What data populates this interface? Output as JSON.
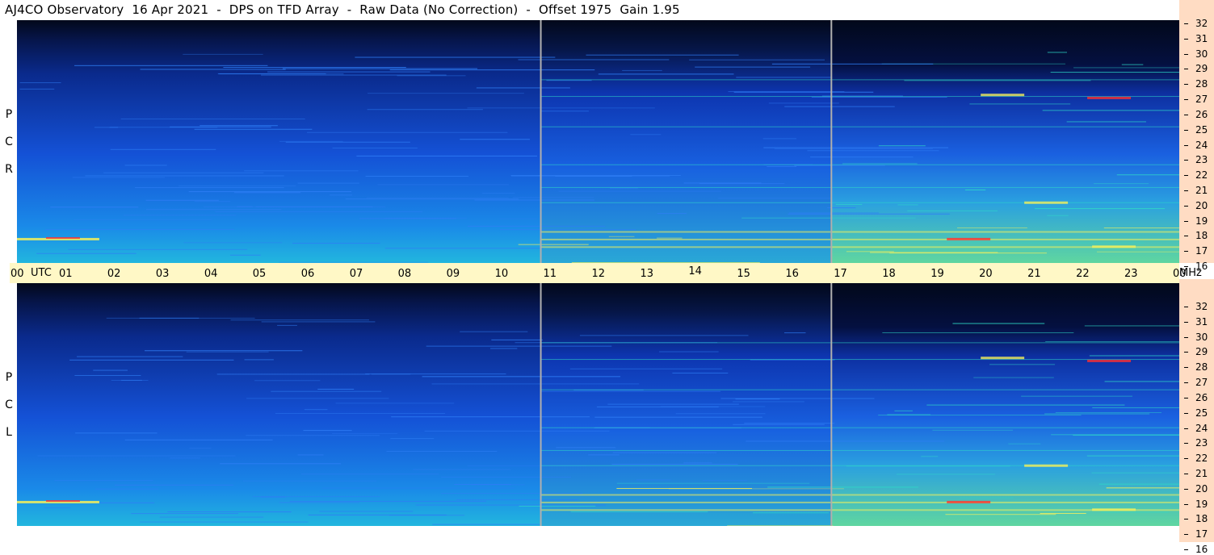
{
  "title": "AJ4CO Observatory  16 Apr 2021  -  DPS on TFD Array  -  Raw Data (No Correction)  -  Offset 1975  Gain 1.95",
  "panels": {
    "rcp": {
      "label_letters": [
        "R",
        "C",
        "P"
      ]
    },
    "lcp": {
      "label_letters": [
        "L",
        "C",
        "P"
      ]
    }
  },
  "time_axis": {
    "unit_label": "UTC",
    "freq_unit": "MHz",
    "ticks": [
      "00",
      "01",
      "02",
      "03",
      "04",
      "05",
      "06",
      "07",
      "08",
      "09",
      "10",
      "11",
      "12",
      "13",
      "14",
      "15",
      "16",
      "17",
      "18",
      "19",
      "20",
      "21",
      "22",
      "23",
      "00"
    ]
  },
  "freq_axis": {
    "ticks": [
      "32",
      "31",
      "30",
      "29",
      "28",
      "27",
      "26",
      "25",
      "24",
      "23",
      "22",
      "21",
      "20",
      "19",
      "18",
      "17",
      "16"
    ]
  },
  "colors": {
    "background": "#02081a",
    "low": "#0a2a8c",
    "mid": "#1c6df0",
    "high": "#2fd9c8",
    "hot": "#f4f05a",
    "peak": "#ff3030",
    "time_axis_bg": "#fff8c6",
    "freq_axis_bg": "#ffdcc3",
    "marker_line": "#b0b0b0"
  },
  "chart_data": {
    "type": "heatmap",
    "title": "AJ4CO Observatory  16 Apr 2021  -  DPS on TFD Array  -  Raw Data (No Correction)  -  Offset 1975  Gain 1.95",
    "xlabel": "UTC",
    "ylabel": "MHz",
    "x_range": [
      "00",
      "00"
    ],
    "y_range": [
      16,
      32
    ],
    "x_ticks": [
      "00",
      "01",
      "02",
      "03",
      "04",
      "05",
      "06",
      "07",
      "08",
      "09",
      "10",
      "11",
      "12",
      "13",
      "14",
      "15",
      "16",
      "17",
      "18",
      "19",
      "20",
      "21",
      "22",
      "23",
      "00"
    ],
    "y_ticks": [
      32,
      31,
      30,
      29,
      28,
      27,
      26,
      25,
      24,
      23,
      22,
      21,
      20,
      19,
      18,
      17,
      16
    ],
    "panels": [
      "RCP",
      "LCP"
    ],
    "vertical_markers_utc": [
      10.8,
      16.8
    ],
    "notable_bands_mhz": [
      17.1,
      17.6,
      18.1,
      20.0,
      21.0,
      22.5,
      25.0,
      27.0,
      28.1
    ],
    "legend": "none"
  }
}
